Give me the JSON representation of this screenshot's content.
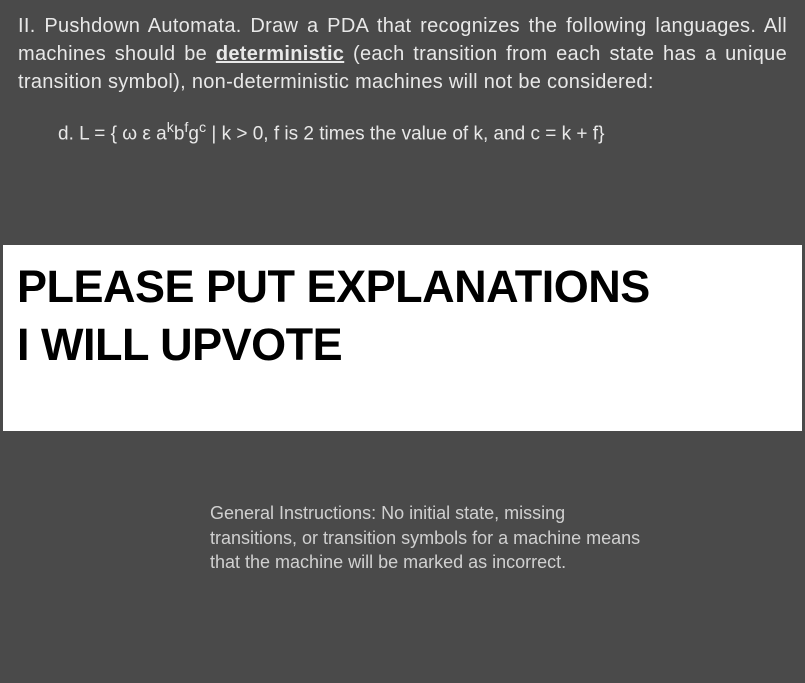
{
  "top": {
    "heading_prefix": "II. Pushdown Automata. Draw a PDA that recognizes the following languages. All machines should be ",
    "heading_underlined": "deterministic",
    "heading_suffix": " (each transition from each state has a unique transition symbol), non-deterministic machines will not be considered:",
    "sub_label": "d.  L = { ω ε a",
    "sup_k": "k",
    "mid_b": "b",
    "sup_f": "f",
    "mid_g": "g",
    "sup_c": "c",
    "sub_rest": " | k > 0, f is 2 times the value of k, and c = k + f}"
  },
  "banner": {
    "line1": "PLEASE PUT EXPLANATIONS",
    "line2": "I WILL UPVOTE"
  },
  "bottom": {
    "instructions": "General Instructions: No initial state, missing transitions, or transition symbols for a machine means that the machine will be marked as incorrect."
  }
}
